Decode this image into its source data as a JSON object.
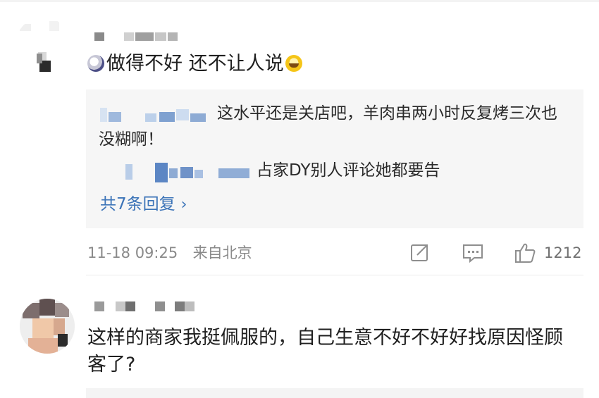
{
  "comments": [
    {
      "text": "做得不好 还不让人说",
      "emoji_left": "stressed-face-emoji",
      "emoji_right": "laughing-crying-emoji",
      "replies": [
        {
          "text": "这水平还是关店吧，羊肉串两小时反复烤三次也没糊啊！"
        },
        {
          "text": "占家DY别人评论她都要告"
        }
      ],
      "more_replies_label": "共7条回复",
      "timestamp": "11-18 09:25",
      "location": "来自北京",
      "like_count": "1212",
      "icons": {
        "share": "share-icon",
        "comment": "comment-icon",
        "like": "thumbs-up-icon"
      }
    },
    {
      "text": "这样的商家我挺佩服的，自己生意不好不好好找原因怪顾客了?"
    }
  ],
  "colors": {
    "text": "#1f1f1f",
    "link": "#3c74b8",
    "meta": "#8a8a8a",
    "reply_bg": "#f6f6f6"
  }
}
